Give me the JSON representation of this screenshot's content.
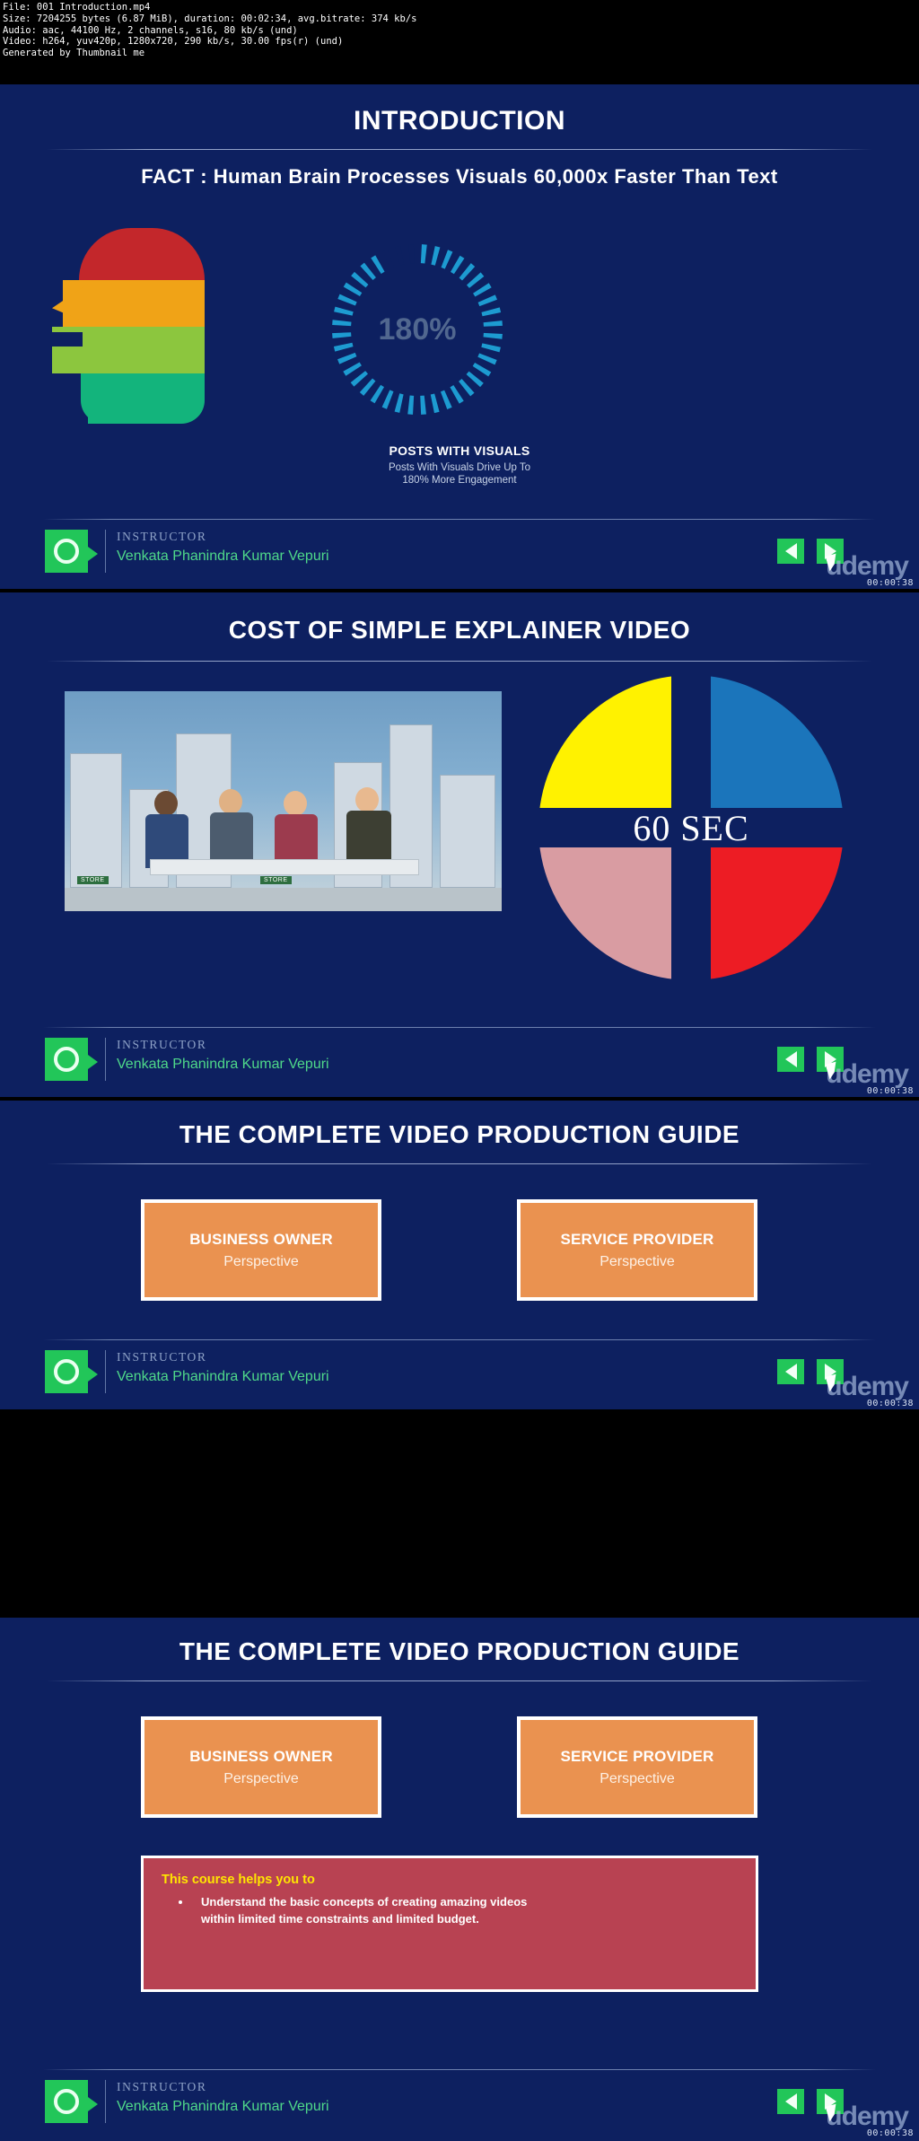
{
  "meta": {
    "lines": [
      "File: 001 Introduction.mp4",
      "Size: 7204255 bytes (6.87 MiB), duration: 00:02:34, avg.bitrate: 374 kb/s",
      "Audio: aac, 44100 Hz, 2 channels, s16, 80 kb/s (und)",
      "Video: h264, yuv420p, 1280x720, 290 kb/s, 30.00 fps(r) (und)",
      "Generated by Thumbnail me"
    ]
  },
  "instructor": {
    "label": "INSTRUCTOR",
    "name": "Venkata Phanindra Kumar Vepuri",
    "prev_icon": "previous-arrow-icon",
    "next_icon": "next-arrow-icon",
    "watermark": "udemy",
    "avatar_icon": "instructor-avatar-icon"
  },
  "frames": [
    {
      "title": "INTRODUCTION",
      "fact": "FACT : Human Brain Processes Visuals 60,000x Faster Than Text",
      "donut": {
        "value_label": "180%",
        "percent": 92,
        "segment_color": "#1d9bd1",
        "caption_title": "POSTS WITH VISUALS",
        "caption_sub_line1": "Posts With Visuals Drive Up To",
        "caption_sub_line2": "180% More Engagement"
      },
      "head_colors": [
        "#c3272b",
        "#f0a317",
        "#8cc63e",
        "#13b47c"
      ],
      "timecode": "00:00:38"
    },
    {
      "title": "COST OF SIMPLE EXPLAINER VIDEO",
      "pie": {
        "center_label": "60 SEC",
        "quadrants": [
          {
            "name": "top-left",
            "color": "#fff200"
          },
          {
            "name": "top-right",
            "color": "#1b75bb"
          },
          {
            "name": "bottom-left",
            "color": "#d99ca2"
          },
          {
            "name": "bottom-right",
            "color": "#ed1c24"
          }
        ]
      },
      "photo_labels": [
        "STORE",
        "STORE"
      ],
      "timecode": "00:00:38"
    },
    {
      "title": "THE COMPLETE VIDEO PRODUCTION GUIDE",
      "cards": [
        {
          "title": "BUSINESS OWNER",
          "sub": "Perspective"
        },
        {
          "title": "SERVICE PROVIDER",
          "sub": "Perspective"
        }
      ],
      "timecode": "00:00:38"
    },
    {
      "title": "THE COMPLETE VIDEO PRODUCTION GUIDE",
      "cards": [
        {
          "title": "BUSINESS OWNER",
          "sub": "Perspective"
        },
        {
          "title": "SERVICE PROVIDER",
          "sub": "Perspective"
        }
      ],
      "callout": {
        "title": "This course helps you to",
        "bullet_line1": "Understand the basic concepts of creating amazing videos",
        "bullet_line2": "within limited time constraints and limited budget."
      },
      "timecode": "00:00:38"
    }
  ],
  "colors": {
    "slide_bg": "#0d2060",
    "accent_green": "#22c659",
    "card_orange": "#ea9250",
    "callout_red": "#b84252"
  }
}
